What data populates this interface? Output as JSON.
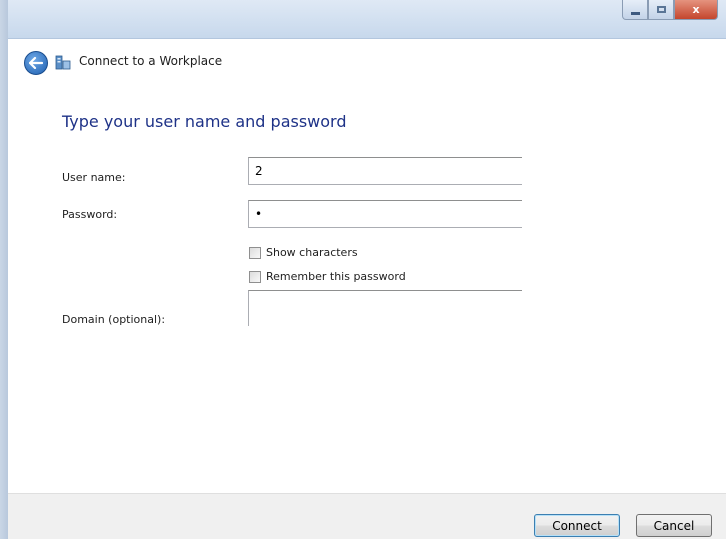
{
  "header": {
    "title": "Connect to a Workplace"
  },
  "form": {
    "heading": "Type your user name and password",
    "username": {
      "label": "User name:",
      "value": "2"
    },
    "password": {
      "label": "Password:",
      "value": "•"
    },
    "show_characters": {
      "label": "Show characters",
      "checked": false
    },
    "remember_password": {
      "label": "Remember this password",
      "checked": false
    },
    "domain": {
      "label": "Domain (optional):",
      "value": ""
    }
  },
  "footer": {
    "connect_label": "Connect",
    "cancel_label": "Cancel"
  },
  "window_controls": {
    "close_glyph": "x"
  }
}
